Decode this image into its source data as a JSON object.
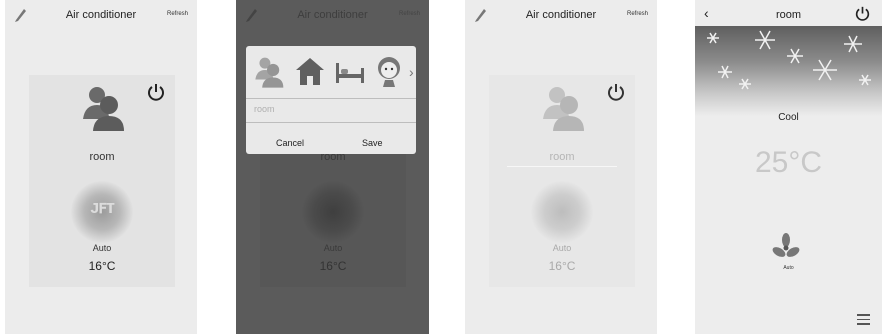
{
  "screens": {
    "main": {
      "title": "Air conditioner",
      "refresh_label": "Refresh",
      "room_name": "room",
      "mode": "Auto",
      "temperature": "16°C"
    },
    "edit_dialog": {
      "background_title": "Air conditioner",
      "background_refresh_label": "Refresh",
      "background_room_name": "room",
      "background_mode": "Auto",
      "background_temperature": "16°C",
      "name_input_value": "room",
      "cancel_label": "Cancel",
      "save_label": "Save",
      "icon_options": [
        "people-icon",
        "house-icon",
        "bed-icon",
        "child-icon"
      ]
    },
    "editing": {
      "title": "Air conditioner",
      "refresh_label": "Refresh",
      "room_name": "room",
      "mode": "Auto",
      "temperature": "16°C"
    },
    "detail": {
      "title": "room",
      "mode": "Cool",
      "temperature": "25°C",
      "fan_label": "Auto"
    }
  },
  "colors": {
    "background": "#ececec",
    "dim_overlay": "#5b5b5b",
    "faded_text": "#c8c8c8"
  }
}
